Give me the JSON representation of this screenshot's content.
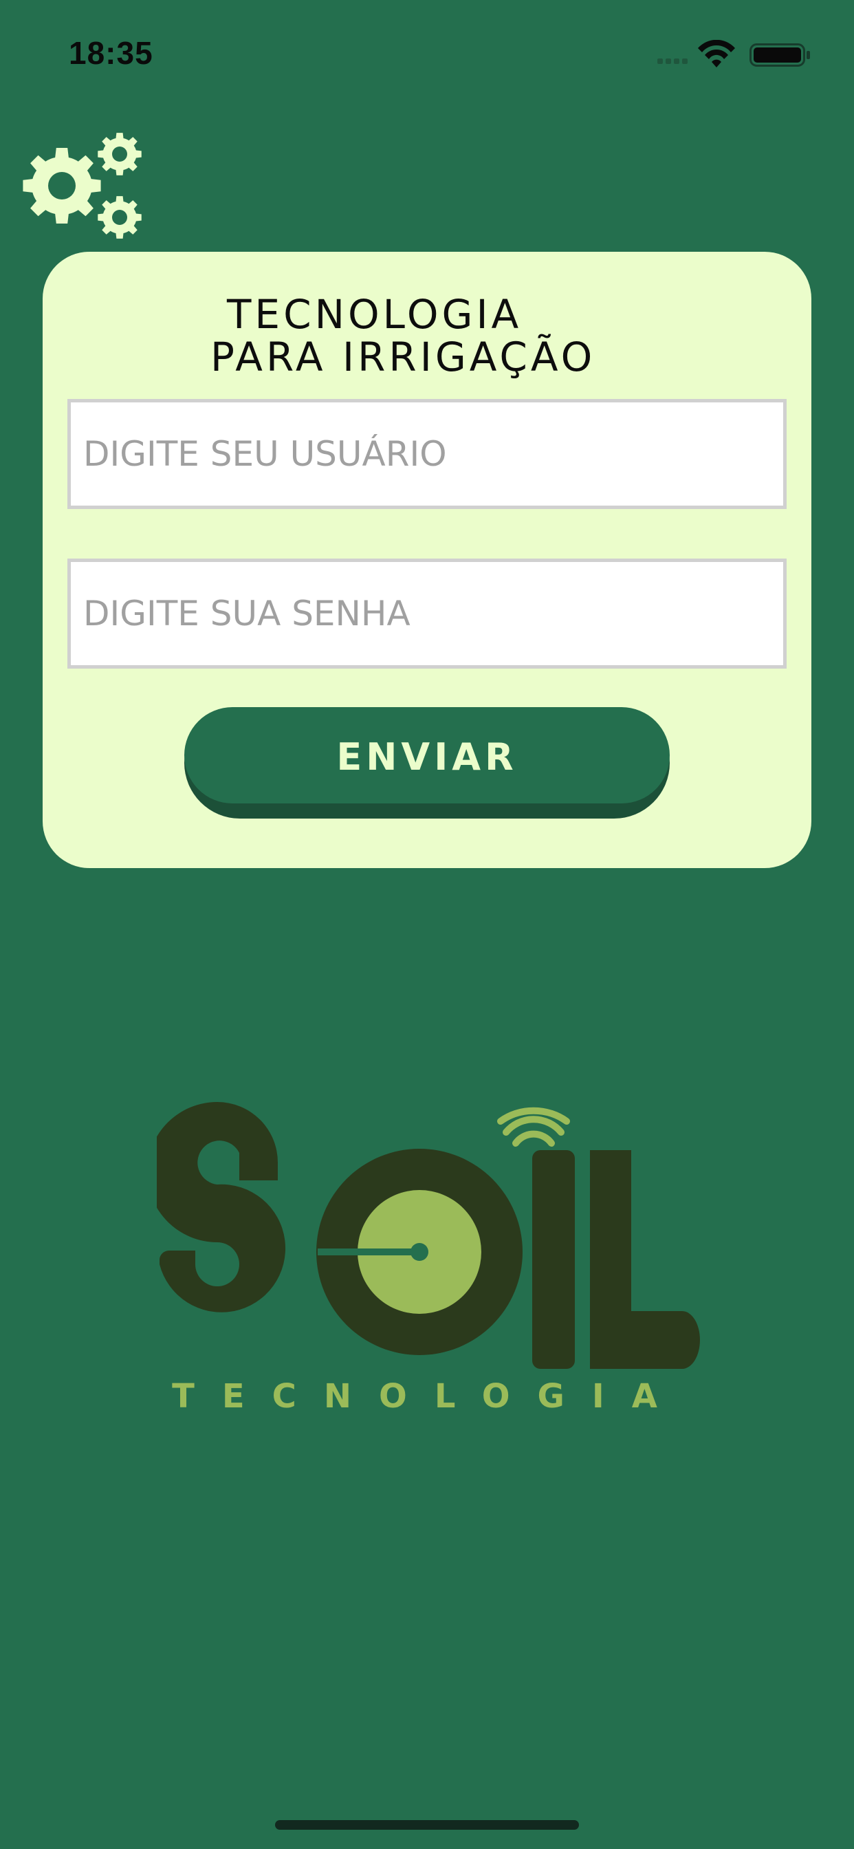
{
  "status_bar": {
    "time": "18:35",
    "icons": [
      "signal-icon",
      "wifi-icon",
      "battery-icon"
    ]
  },
  "header": {
    "icon": "gears-icon"
  },
  "login_card": {
    "title_line1": "TECNOLOGIA",
    "title_line2": "PARA IRRIGAÇÃO",
    "username_placeholder": "DIGITE SEU USUÁRIO",
    "username_value": "",
    "password_placeholder": "DIGITE SUA SENHA",
    "password_value": "",
    "submit_label": "ENVIAR"
  },
  "logo": {
    "wordmark": "SOIL",
    "tagline": "TECNOLOGIA"
  },
  "colors": {
    "background": "#246F4E",
    "card": "#EBFDCB",
    "button": "#246F4E",
    "button_shadow": "#1C5038",
    "logo_dark": "#2B3A1C",
    "logo_light": "#9BBB59"
  }
}
